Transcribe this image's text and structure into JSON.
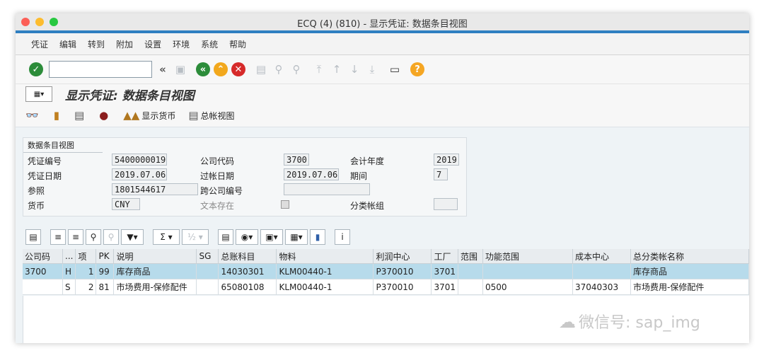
{
  "window": {
    "title": "ECQ (4) (810) - 显示凭证: 数据条目视图"
  },
  "menu": [
    "凭证",
    "编辑",
    "转到",
    "附加",
    "设置",
    "环境",
    "系统",
    "帮助"
  ],
  "toolbar": {
    "back_symbol": "«",
    "command_placeholder": ""
  },
  "page": {
    "title": "显示凭证: 数据条目视图"
  },
  "app_toolbar": {
    "currency_label": "显示货币",
    "ledger_label": "总帐视图"
  },
  "header": {
    "group_title": "数据条目视图",
    "doc_no_label": "凭证编号",
    "doc_no": "5400000019",
    "company_label": "公司代码",
    "company": "3700",
    "fiscal_year_label": "会计年度",
    "fiscal_year": "2019",
    "doc_date_label": "凭证日期",
    "doc_date": "2019.07.06",
    "posting_date_label": "过帐日期",
    "posting_date": "2019.07.06",
    "period_label": "期间",
    "period": "7",
    "reference_label": "参照",
    "reference": "1801544617",
    "cross_company_label": "跨公司编号",
    "currency_label": "货币",
    "currency": "CNY",
    "text_label": "文本存在",
    "ledger_group_label": "分类帐组"
  },
  "table": {
    "headers": [
      "公司码",
      "...",
      "项",
      "PK",
      "说明",
      "SG",
      "总账科目",
      "物料",
      "利润中心",
      "工厂",
      "范围",
      "功能范围",
      "成本中心",
      "总分类帐名称"
    ],
    "rows": [
      [
        "3700",
        "H",
        "1",
        "99",
        "库存商品",
        "",
        "14030301",
        "KLM00440-1",
        "P370010",
        "3701",
        "",
        "",
        "",
        "库存商品"
      ],
      [
        "",
        "S",
        "2",
        "81",
        "市场费用-保修配件",
        "",
        "65080108",
        "KLM00440-1",
        "P370010",
        "3701",
        "",
        "0500",
        "37040303",
        "市场费用-保修配件"
      ]
    ]
  },
  "watermark": "微信号: sap_img"
}
